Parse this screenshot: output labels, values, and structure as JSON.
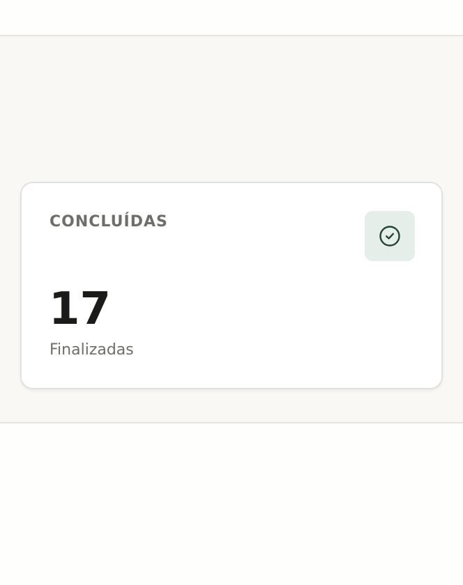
{
  "stat_card": {
    "label": "CONCLUÍDAS",
    "value": "17",
    "subtitle": "Finalizadas",
    "icon": "check-circle-icon"
  },
  "colors": {
    "page_background": "#fefefd",
    "band_background": "#f9f8f5",
    "card_background": "#ffffff",
    "icon_background": "#e5eee9",
    "icon_color": "#234236",
    "label_color": "#6f6e68",
    "value_color": "#1b1b19"
  }
}
